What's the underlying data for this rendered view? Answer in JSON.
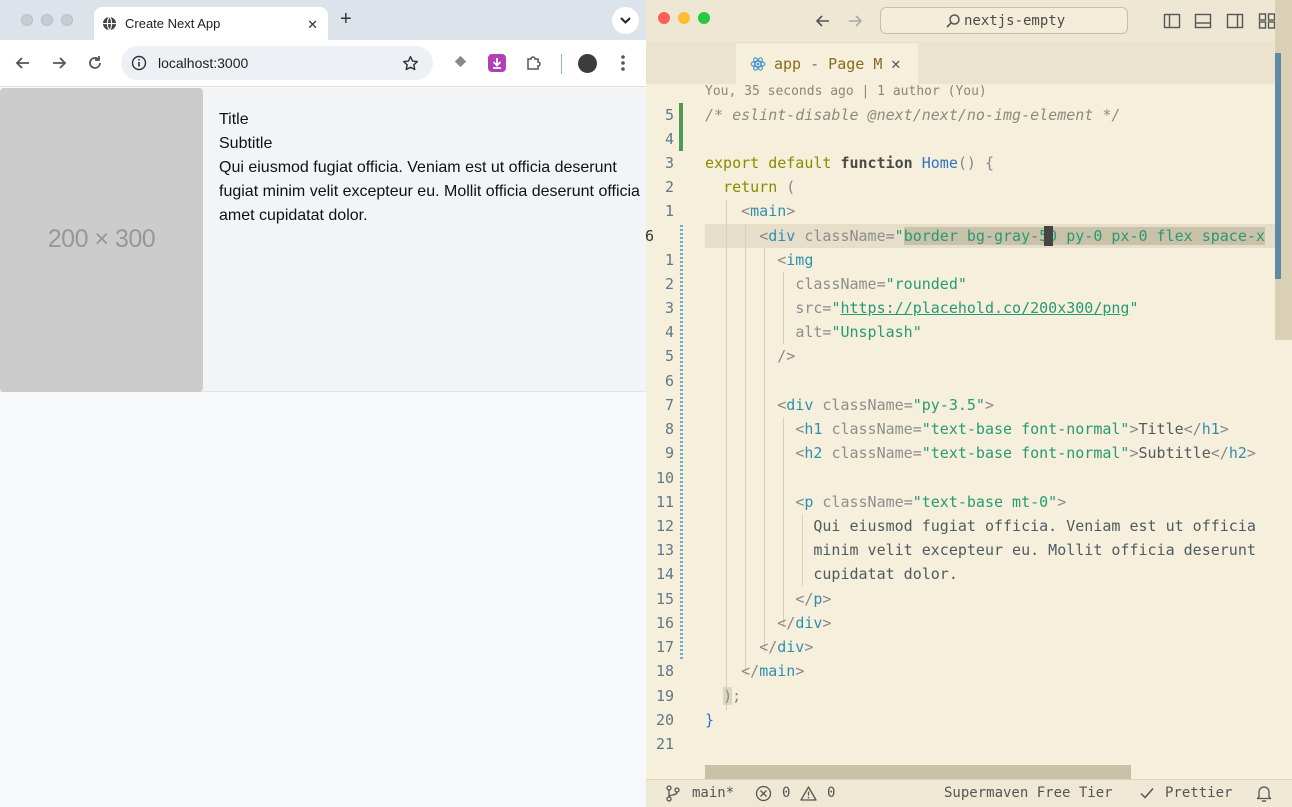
{
  "browser": {
    "tab_title": "Create Next App",
    "url": "localhost:3000",
    "placeholder_label": "200 × 300",
    "card": {
      "title": "Title",
      "subtitle": "Subtitle",
      "paragraph": "Qui eiusmod fugiat officia. Veniam est ut officia deserunt fugiat minim velit excepteur eu. Mollit officia deserunt officia amet cupidatat dolor."
    }
  },
  "editor": {
    "search_text": "nextjs-empty",
    "tab_title": "app - Page M",
    "blame": "You, 35 seconds ago | 1 author (You)",
    "line_numbers": [
      "5",
      "4",
      "3",
      "2",
      "1",
      "6",
      "1",
      "2",
      "3",
      "4",
      "5",
      "6",
      "7",
      "8",
      "9",
      "10",
      "11",
      "12",
      "13",
      "14",
      "15",
      "16",
      "17",
      "18",
      "19",
      "20",
      "21"
    ],
    "status": {
      "branch": "main*",
      "errors": "0",
      "warnings": "0",
      "supermaven": "Supermaven Free Tier",
      "prettier": "Prettier"
    }
  },
  "colors": {
    "accent_green": "#4c9a53",
    "editor_bg": "#f6efdc",
    "browser_bg": "#f7f8fa"
  }
}
